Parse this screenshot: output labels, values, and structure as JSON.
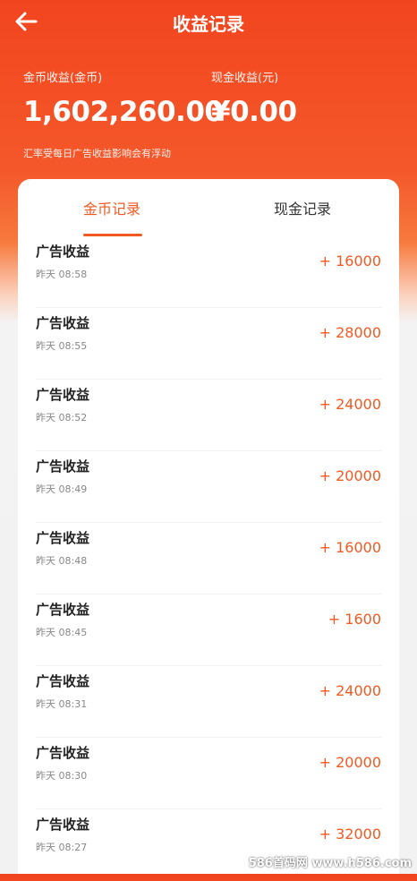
{
  "header": {
    "title": "收益记录"
  },
  "summary": {
    "coin_label": "金币收益(金币)",
    "coin_value": "1,602,260.00",
    "cash_label": "现金收益(元)",
    "cash_value": "¥0.00",
    "note": "汇率受每日广告收益影响会有浮动"
  },
  "tabs": [
    {
      "label": "金币记录",
      "active": true
    },
    {
      "label": "现金记录",
      "active": false
    }
  ],
  "records": [
    {
      "title": "广告收益",
      "time": "昨天 08:58",
      "amount": "+ 16000"
    },
    {
      "title": "广告收益",
      "time": "昨天 08:55",
      "amount": "+ 28000"
    },
    {
      "title": "广告收益",
      "time": "昨天 08:52",
      "amount": "+ 24000"
    },
    {
      "title": "广告收益",
      "time": "昨天 08:49",
      "amount": "+ 20000"
    },
    {
      "title": "广告收益",
      "time": "昨天 08:48",
      "amount": "+ 16000"
    },
    {
      "title": "广告收益",
      "time": "昨天 08:45",
      "amount": "+ 1600"
    },
    {
      "title": "广告收益",
      "time": "昨天 08:31",
      "amount": "+ 24000"
    },
    {
      "title": "广告收益",
      "time": "昨天 08:30",
      "amount": "+ 20000"
    },
    {
      "title": "广告收益",
      "time": "昨天 08:27",
      "amount": "+ 32000"
    }
  ],
  "watermark": "586首码网 www.h586.com",
  "colors": {
    "accent": "#f05a22",
    "header": "#f2451f"
  }
}
